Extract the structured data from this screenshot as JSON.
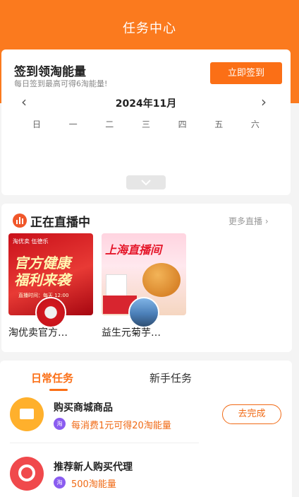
{
  "header": {
    "title": "任务中心"
  },
  "checkin": {
    "title": "签到领淘能量",
    "subtitle": "每日签到最高可得6淘能量!",
    "button_label": "立即签到",
    "month": "2024年11月",
    "prev_icon": "chevron-left-icon",
    "next_icon": "chevron-right-icon",
    "weekdays": [
      "日",
      "一",
      "二",
      "三",
      "四",
      "五",
      "六"
    ],
    "expand_icon": "chevron-down-icon"
  },
  "live": {
    "title": "正在直播中",
    "more_label": "更多直播",
    "more_icon": "›",
    "items": [
      {
        "name": "淘优卖官方…",
        "thumb_top": "淘优卖  伍德乐",
        "thumb_big_1": "官方健康",
        "thumb_big_2": "福利来袭",
        "thumb_small": "直播时间：每天 12:00"
      },
      {
        "name": "益生元菊芋…",
        "thumb_big": "上海直播间"
      }
    ]
  },
  "tasks": {
    "tabs": [
      {
        "label": "日常任务",
        "active": true
      },
      {
        "label": "新手任务",
        "active": false
      }
    ],
    "items": [
      {
        "title": "购买商城商品",
        "coin": "淘",
        "reward": "每消费1元可得20淘能量",
        "button": "去完成",
        "icon": "envelope-icon",
        "icon_color": "#ffb02c"
      },
      {
        "title": "推荐新人购买代理",
        "coin": "淘",
        "reward": "500淘能量",
        "icon": "flower-icon",
        "icon_color": "#f0494c"
      }
    ]
  },
  "colors": {
    "brand": "#fb7a1e",
    "accent": "#f06a15",
    "coin": "#8a5cf0"
  }
}
